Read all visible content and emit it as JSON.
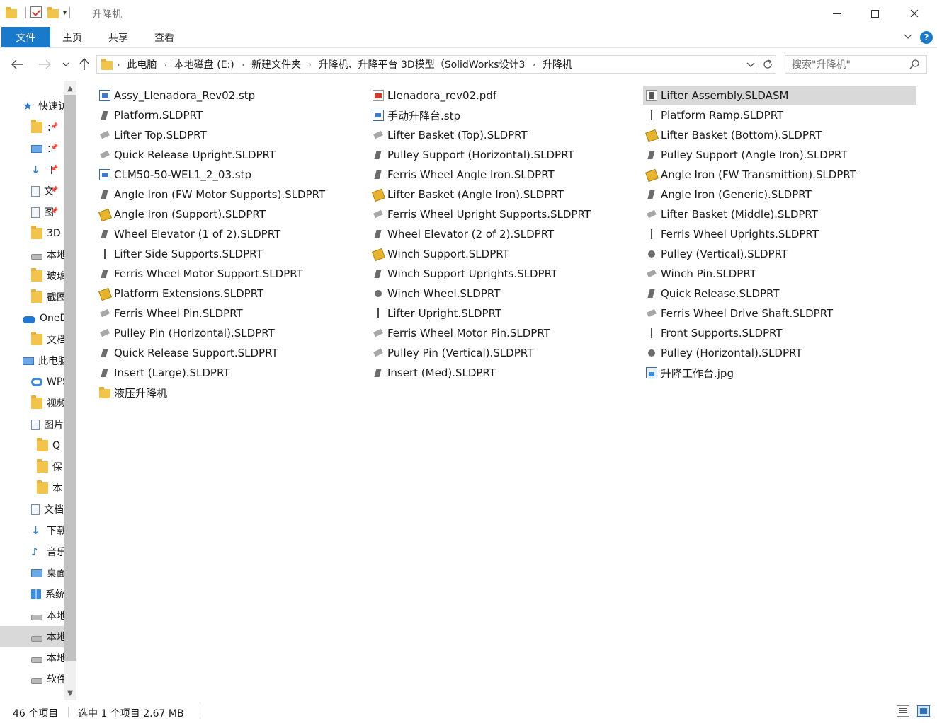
{
  "window": {
    "title": "升降机",
    "controls": {
      "minimize": "minimize-icon",
      "maximize": "maximize-icon",
      "close": "close-icon"
    }
  },
  "ribbon": {
    "tabs": [
      {
        "label": "文件",
        "active": true
      },
      {
        "label": "主页"
      },
      {
        "label": "共享"
      },
      {
        "label": "查看"
      }
    ],
    "help": "?"
  },
  "address": {
    "crumbs": [
      "此电脑",
      "本地磁盘 (E:)",
      "新建文件夹",
      "升降机、升降平台 3D模型（SolidWorks设计3",
      "升降机"
    ]
  },
  "search": {
    "placeholder": "搜索\"升降机\""
  },
  "sidebar": {
    "items": [
      {
        "label": "快速访问",
        "icon": "star-icon"
      },
      {
        "label": "：",
        "icon": "folder-icon",
        "pinned": true
      },
      {
        "label": "：",
        "icon": "desktop-icon",
        "pinned": true
      },
      {
        "label": "下",
        "icon": "download-icon",
        "pinned": true
      },
      {
        "label": "文",
        "icon": "document-icon",
        "pinned": true
      },
      {
        "label": "图",
        "icon": "picture-icon",
        "pinned": true
      },
      {
        "label": "3D",
        "icon": "folder-icon"
      },
      {
        "label": "本地",
        "icon": "drive-icon"
      },
      {
        "label": "玻璃",
        "icon": "folder-icon"
      },
      {
        "label": "截图",
        "icon": "folder-icon"
      },
      {
        "label": "OneDrive",
        "icon": "onedrive-icon"
      },
      {
        "label": "文档",
        "icon": "folder-icon"
      },
      {
        "label": "此电脑",
        "icon": "computer-icon"
      },
      {
        "label": "WPS",
        "icon": "wps-icon"
      },
      {
        "label": "视频",
        "icon": "video-icon"
      },
      {
        "label": "图片",
        "icon": "picture-icon"
      },
      {
        "label": "Q",
        "icon": "folder-icon"
      },
      {
        "label": "保",
        "icon": "folder-icon"
      },
      {
        "label": "本",
        "icon": "folder-icon"
      },
      {
        "label": "文档",
        "icon": "document-icon"
      },
      {
        "label": "下载",
        "icon": "download-icon"
      },
      {
        "label": "音乐",
        "icon": "music-icon"
      },
      {
        "label": "桌面",
        "icon": "desktop-icon"
      },
      {
        "label": "系统",
        "icon": "windows-icon"
      },
      {
        "label": "本地",
        "icon": "drive-icon"
      },
      {
        "label": "本地",
        "icon": "drive-icon",
        "selected": true
      },
      {
        "label": "本地",
        "icon": "drive-icon"
      },
      {
        "label": "软件",
        "icon": "drive-icon"
      }
    ]
  },
  "files": {
    "columns": [
      [
        {
          "name": "Assy_Llenadora_Rev02.stp",
          "icon": "stp-file-icon"
        },
        {
          "name": "Platform.SLDPRT",
          "icon": "part-icon"
        },
        {
          "name": "Lifter Top.SLDPRT",
          "icon": "part-gray-icon"
        },
        {
          "name": "Quick Release Upright.SLDPRT",
          "icon": "part-gray-icon"
        },
        {
          "name": "CLM50-50-WEL1_2_03.stp",
          "icon": "stp-file-icon"
        },
        {
          "name": "Angle Iron (FW Motor Supports).SLDPRT",
          "icon": "part-icon"
        },
        {
          "name": "Angle Iron (Support).SLDPRT",
          "icon": "part-yellow-icon"
        },
        {
          "name": "Wheel Elevator (1 of 2).SLDPRT",
          "icon": "part-icon"
        },
        {
          "name": "Lifter Side Supports.SLDPRT",
          "icon": "part-thin-icon"
        },
        {
          "name": "Ferris Wheel Motor Support.SLDPRT",
          "icon": "part-icon"
        },
        {
          "name": "Platform Extensions.SLDPRT",
          "icon": "part-yellow-icon"
        },
        {
          "name": "Ferris Wheel Pin.SLDPRT",
          "icon": "part-gray-icon"
        },
        {
          "name": "Pulley Pin (Horizontal).SLDPRT",
          "icon": "part-gray-icon"
        },
        {
          "name": "Quick Release Support.SLDPRT",
          "icon": "part-icon"
        },
        {
          "name": "Insert (Large).SLDPRT",
          "icon": "part-icon"
        },
        {
          "name": "液压升降机",
          "icon": "folder-icon"
        }
      ],
      [
        {
          "name": "Llenadora_rev02.pdf",
          "icon": "pdf-file-icon"
        },
        {
          "name": "手动升降台.stp",
          "icon": "stp-file-icon"
        },
        {
          "name": "Lifter Basket (Top).SLDPRT",
          "icon": "part-gray-icon"
        },
        {
          "name": "Pulley Support (Horizontal).SLDPRT",
          "icon": "part-icon"
        },
        {
          "name": "Ferris Wheel Angle Iron.SLDPRT",
          "icon": "part-icon"
        },
        {
          "name": "Lifter Basket (Angle Iron).SLDPRT",
          "icon": "part-yellow-icon"
        },
        {
          "name": "Ferris Wheel Upright Supports.SLDPRT",
          "icon": "part-gray-icon"
        },
        {
          "name": "Wheel Elevator (2 of 2).SLDPRT",
          "icon": "part-icon"
        },
        {
          "name": "Winch Support.SLDPRT",
          "icon": "part-yellow-icon"
        },
        {
          "name": "Winch Support Uprights.SLDPRT",
          "icon": "part-icon"
        },
        {
          "name": "Winch Wheel.SLDPRT",
          "icon": "part-round-icon"
        },
        {
          "name": "Lifter Upright.SLDPRT",
          "icon": "part-thin-icon"
        },
        {
          "name": "Ferris Wheel Motor Pin.SLDPRT",
          "icon": "part-gray-icon"
        },
        {
          "name": "Pulley Pin (Vertical).SLDPRT",
          "icon": "part-gray-icon"
        },
        {
          "name": "Insert (Med).SLDPRT",
          "icon": "part-icon"
        }
      ],
      [
        {
          "name": "Lifter Assembly.SLDASM",
          "icon": "assembly-icon",
          "selected": true
        },
        {
          "name": "Platform Ramp.SLDPRT",
          "icon": "part-thin-icon"
        },
        {
          "name": "Lifter Basket (Bottom).SLDPRT",
          "icon": "part-yellow-icon"
        },
        {
          "name": "Pulley Support (Angle Iron).SLDPRT",
          "icon": "part-icon"
        },
        {
          "name": "Angle Iron (FW Transmittion).SLDPRT",
          "icon": "part-yellow-icon"
        },
        {
          "name": "Angle Iron (Generic).SLDPRT",
          "icon": "part-icon"
        },
        {
          "name": "Lifter Basket (Middle).SLDPRT",
          "icon": "part-gray-icon"
        },
        {
          "name": "Ferris Wheel Uprights.SLDPRT",
          "icon": "part-thin-icon"
        },
        {
          "name": "Pulley (Vertical).SLDPRT",
          "icon": "part-round-icon"
        },
        {
          "name": "Winch Pin.SLDPRT",
          "icon": "part-gray-icon"
        },
        {
          "name": "Quick Release.SLDPRT",
          "icon": "part-icon"
        },
        {
          "name": "Ferris Wheel Drive Shaft.SLDPRT",
          "icon": "part-gray-icon"
        },
        {
          "name": "Front Supports.SLDPRT",
          "icon": "part-thin-icon"
        },
        {
          "name": "Pulley (Horizontal).SLDPRT",
          "icon": "part-round-icon"
        },
        {
          "name": "升降工作台.jpg",
          "icon": "jpg-file-icon"
        }
      ]
    ]
  },
  "status": {
    "count": "46 个项目",
    "selection": "选中 1 个项目  2.67 MB"
  }
}
